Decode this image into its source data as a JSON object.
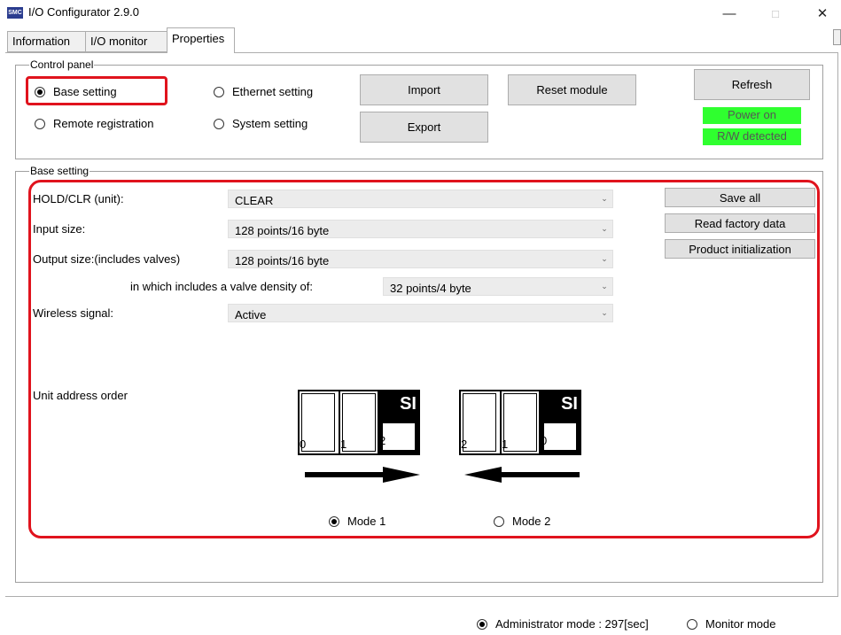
{
  "window": {
    "title": "I/O Configurator 2.9.0",
    "app_icon_text": "SMC",
    "controls": {
      "minimize": "—",
      "maximize": "□",
      "close": "✕"
    }
  },
  "tabs": [
    {
      "label": "Information",
      "active": false
    },
    {
      "label": "I/O monitor",
      "active": false
    },
    {
      "label": "Properties",
      "active": true
    }
  ],
  "control_panel": {
    "legend": "Control panel",
    "radios": [
      {
        "label": "Base setting",
        "selected": true
      },
      {
        "label": "Ethernet setting",
        "selected": false
      },
      {
        "label": "Remote registration",
        "selected": false
      },
      {
        "label": "System setting",
        "selected": false
      }
    ],
    "import_label": "Import",
    "export_label": "Export",
    "reset_module_label": "Reset module",
    "refresh_label": "Refresh",
    "power_status": "Power on",
    "rw_status": "R/W detected",
    "status_color": "#2fff2f"
  },
  "base_setting": {
    "legend": "Base setting",
    "fields": [
      {
        "label": "HOLD/CLR (unit):",
        "value": "CLEAR"
      },
      {
        "label": "Input size:",
        "value": "128 points/16 byte"
      },
      {
        "label": "Output size:(includes valves)",
        "value": "128 points/16 byte"
      },
      {
        "label": "in which includes a valve density of:",
        "value": "32 points/4 byte"
      },
      {
        "label": "Wireless signal:",
        "value": "Active"
      }
    ],
    "save_all_label": "Save all",
    "read_factory_label": "Read factory data",
    "product_init_label": "Product initialization",
    "unit_address_label": "Unit address order",
    "mode1": {
      "label": "Mode 1",
      "selected": true,
      "numbers": [
        "0",
        "1",
        "2"
      ],
      "si": "SI",
      "arrow": "right"
    },
    "mode2": {
      "label": "Mode 2",
      "selected": false,
      "numbers": [
        "2",
        "1",
        "0"
      ],
      "si": "SI",
      "arrow": "left"
    }
  },
  "footer": {
    "admin_mode": {
      "label": "Administrator mode : 297[sec]",
      "selected": true
    },
    "monitor_mode": {
      "label": "Monitor mode",
      "selected": false
    }
  },
  "highlight_color": "#e0131d"
}
